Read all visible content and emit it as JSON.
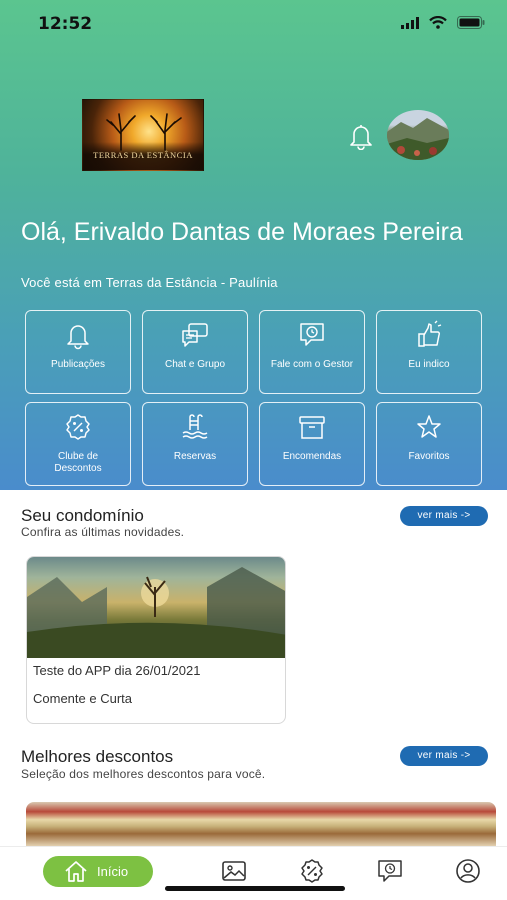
{
  "status": {
    "time": "12:52"
  },
  "header": {
    "logo_text": "TERRAS DA ESTÂNCIA",
    "greeting": "Olá, Erivaldo Dantas de Moraes Pereira",
    "location": "Você está em Terras da Estância - Paulínia"
  },
  "tiles": [
    {
      "label": "Publicações",
      "icon": "bell-icon"
    },
    {
      "label": "Chat e Grupo",
      "icon": "chat-icon"
    },
    {
      "label": "Fale com o Gestor",
      "icon": "message-clock-icon"
    },
    {
      "label": "Eu indico",
      "icon": "thumbs-up-icon"
    },
    {
      "label": "Clube de Descontos",
      "icon": "discount-badge-icon"
    },
    {
      "label": "Reservas",
      "icon": "pool-icon"
    },
    {
      "label": "Encomendas",
      "icon": "archive-box-icon"
    },
    {
      "label": "Favoritos",
      "icon": "star-icon"
    }
  ],
  "condominio": {
    "title": "Seu condomínio",
    "subtitle": "Confira as últimas novidades.",
    "more": "ver mais ->",
    "post": {
      "title": "Teste do APP dia 26/01/2021",
      "body": "Comente e Curta"
    }
  },
  "descontos": {
    "title": "Melhores descontos",
    "subtitle": "Seleção dos melhores descontos para você.",
    "more": "ver mais ->"
  },
  "tabbar": {
    "home_label": "Início",
    "items": [
      "gallery-icon",
      "discount-icon",
      "chat-clock-icon",
      "profile-icon"
    ]
  },
  "colors": {
    "accent_green": "#7dc142",
    "pill_blue": "#1f6bb2",
    "hero_top": "#5bc58f",
    "hero_bottom": "#4a8ccc"
  }
}
